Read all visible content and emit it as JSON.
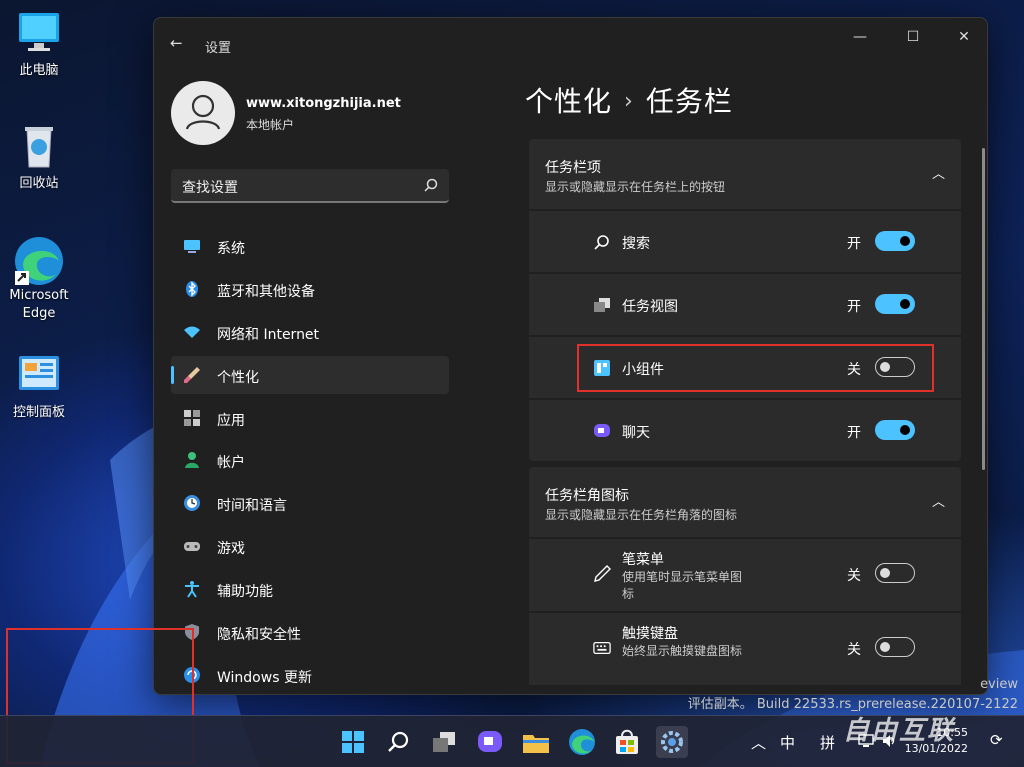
{
  "desktop": {
    "icons": [
      {
        "label": "此电脑"
      },
      {
        "label": "回收站"
      },
      {
        "label": "Microsoft Edge"
      },
      {
        "label": "控制面板"
      }
    ],
    "watermark_line1": "eview",
    "watermark_line2": "评估副本。 Build 22533.rs_prerelease.220107-2122",
    "brand": "自由互联"
  },
  "window": {
    "title": "设置",
    "controls": {
      "minimize": "—",
      "maximize": "☐",
      "close": "✕"
    }
  },
  "profile": {
    "name": "www.xitongzhijia.net",
    "account_type": "本地帐户"
  },
  "search": {
    "placeholder": "查找设置"
  },
  "sidebar": {
    "items": [
      {
        "label": "系统",
        "icon": "system-icon"
      },
      {
        "label": "蓝牙和其他设备",
        "icon": "bluetooth-icon"
      },
      {
        "label": "网络和 Internet",
        "icon": "wifi-icon"
      },
      {
        "label": "个性化",
        "icon": "brush-icon",
        "active": true
      },
      {
        "label": "应用",
        "icon": "apps-icon"
      },
      {
        "label": "帐户",
        "icon": "account-icon"
      },
      {
        "label": "时间和语言",
        "icon": "time-language-icon"
      },
      {
        "label": "游戏",
        "icon": "gamepad-icon"
      },
      {
        "label": "辅助功能",
        "icon": "accessibility-icon"
      },
      {
        "label": "隐私和安全性",
        "icon": "shield-icon"
      },
      {
        "label": "Windows 更新",
        "icon": "windows-update-icon"
      }
    ]
  },
  "breadcrumb": {
    "parent": "个性化",
    "separator": "›",
    "current": "任务栏"
  },
  "taskbar_items": {
    "title": "任务栏项",
    "subtitle": "显示或隐藏显示在任务栏上的按钮",
    "rows": [
      {
        "label": "搜索",
        "state": "开",
        "on": true
      },
      {
        "label": "任务视图",
        "state": "开",
        "on": true
      },
      {
        "label": "小组件",
        "state": "关",
        "on": false
      },
      {
        "label": "聊天",
        "state": "开",
        "on": true
      }
    ]
  },
  "corner_icons": {
    "title": "任务栏角图标",
    "subtitle": "显示或隐藏显示在任务栏角落的图标",
    "rows": [
      {
        "label": "笔菜单",
        "sub": "使用笔时显示笔菜单图标",
        "state": "关",
        "on": false
      },
      {
        "label": "触摸键盘",
        "sub": "始终显示触摸键盘图标",
        "state": "关",
        "on": false
      }
    ]
  },
  "tray": {
    "ime_mode": "中",
    "ime_layout": "拼",
    "time": "10:55",
    "date": "13/01/2022"
  },
  "colors": {
    "accent": "#4cc2ff",
    "highlight": "#e0302a",
    "window_bg": "#202020",
    "card_bg": "#2b2b2b"
  }
}
